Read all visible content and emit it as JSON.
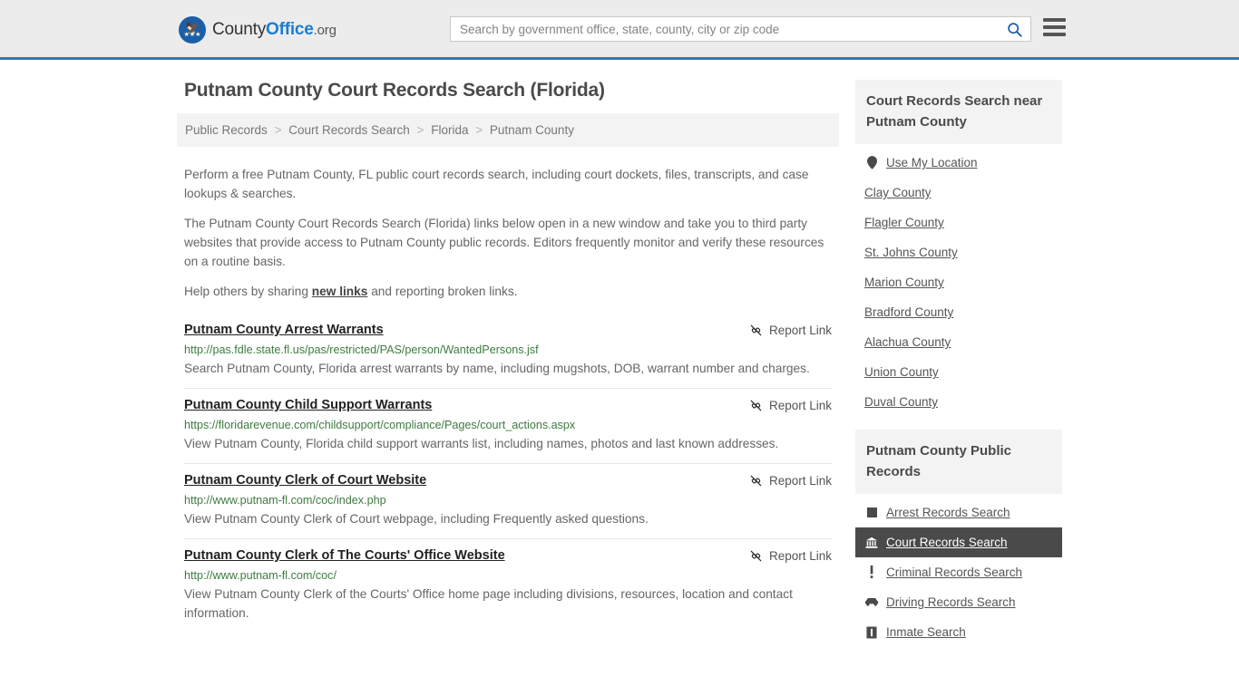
{
  "header": {
    "logo": {
      "part1": "County",
      "part2": "Office",
      "part3": ".org",
      "icon": "eagle-shield-icon"
    },
    "search": {
      "placeholder": "Search by government office, state, county, city or zip code",
      "value": "",
      "button_icon": "search-icon"
    },
    "menu_icon": "hamburger-menu-icon"
  },
  "main": {
    "title": "Putnam County Court Records Search (Florida)",
    "breadcrumb": [
      {
        "label": "Public Records"
      },
      {
        "label": "Court Records Search"
      },
      {
        "label": "Florida"
      },
      {
        "label": "Putnam County"
      }
    ],
    "breadcrumb_separator": ">",
    "paragraphs": [
      "Perform a free Putnam County, FL public court records search, including court dockets, files, transcripts, and case lookups & searches.",
      "The Putnam County Court Records Search (Florida) links below open in a new window and take you to third party websites that provide access to Putnam County public records. Editors frequently monitor and verify these resources on a routine basis."
    ],
    "help_text_before": "Help others by sharing ",
    "help_link": "new links",
    "help_text_after": " and reporting broken links.",
    "report_link_label": "Report Link",
    "report_link_icon": "broken-link-icon",
    "entries": [
      {
        "title": "Putnam County Arrest Warrants",
        "url": "http://pas.fdle.state.fl.us/pas/restricted/PAS/person/WantedPersons.jsf",
        "description": "Search Putnam County, Florida arrest warrants by name, including mugshots, DOB, warrant number and charges."
      },
      {
        "title": "Putnam County Child Support Warrants",
        "url": "https://floridarevenue.com/childsupport/compliance/Pages/court_actions.aspx",
        "description": "View Putnam County, Florida child support warrants list, including names, photos and last known addresses."
      },
      {
        "title": "Putnam County Clerk of Court Website",
        "url": "http://www.putnam-fl.com/coc/index.php",
        "description": "View Putnam County Clerk of Court webpage, including Frequently asked questions."
      },
      {
        "title": "Putnam County Clerk of The Courts' Office Website",
        "url": "http://www.putnam-fl.com/coc/",
        "description": "View Putnam County Clerk of the Courts' Office home page including divisions, resources, location and contact information."
      }
    ]
  },
  "sidebar": {
    "nearby": {
      "heading": "Court Records Search near Putnam County",
      "items": [
        {
          "label": "Use My Location",
          "icon": "map-pin-icon"
        },
        {
          "label": "Clay County",
          "icon": ""
        },
        {
          "label": "Flagler County",
          "icon": ""
        },
        {
          "label": "St. Johns County",
          "icon": ""
        },
        {
          "label": "Marion County",
          "icon": ""
        },
        {
          "label": "Bradford County",
          "icon": ""
        },
        {
          "label": "Alachua County",
          "icon": ""
        },
        {
          "label": "Union County",
          "icon": ""
        },
        {
          "label": "Duval County",
          "icon": ""
        }
      ]
    },
    "public_records": {
      "heading": "Putnam County Public Records",
      "items": [
        {
          "label": "Arrest Records Search",
          "icon": "square-icon",
          "active": false
        },
        {
          "label": "Court Records Search",
          "icon": "courthouse-icon",
          "active": true
        },
        {
          "label": "Criminal Records Search",
          "icon": "exclamation-icon",
          "active": false
        },
        {
          "label": "Driving Records Search",
          "icon": "car-icon",
          "active": false
        },
        {
          "label": "Inmate Search",
          "icon": "inmate-icon",
          "active": false
        }
      ]
    }
  },
  "colors": {
    "header_bg": "#ececec",
    "header_border": "#3b76a5",
    "url_green": "#3d7c40",
    "active_bg": "#4a4a4a",
    "panel_bg": "#f3f3f3",
    "logo_blue": "#1a7ed1"
  }
}
